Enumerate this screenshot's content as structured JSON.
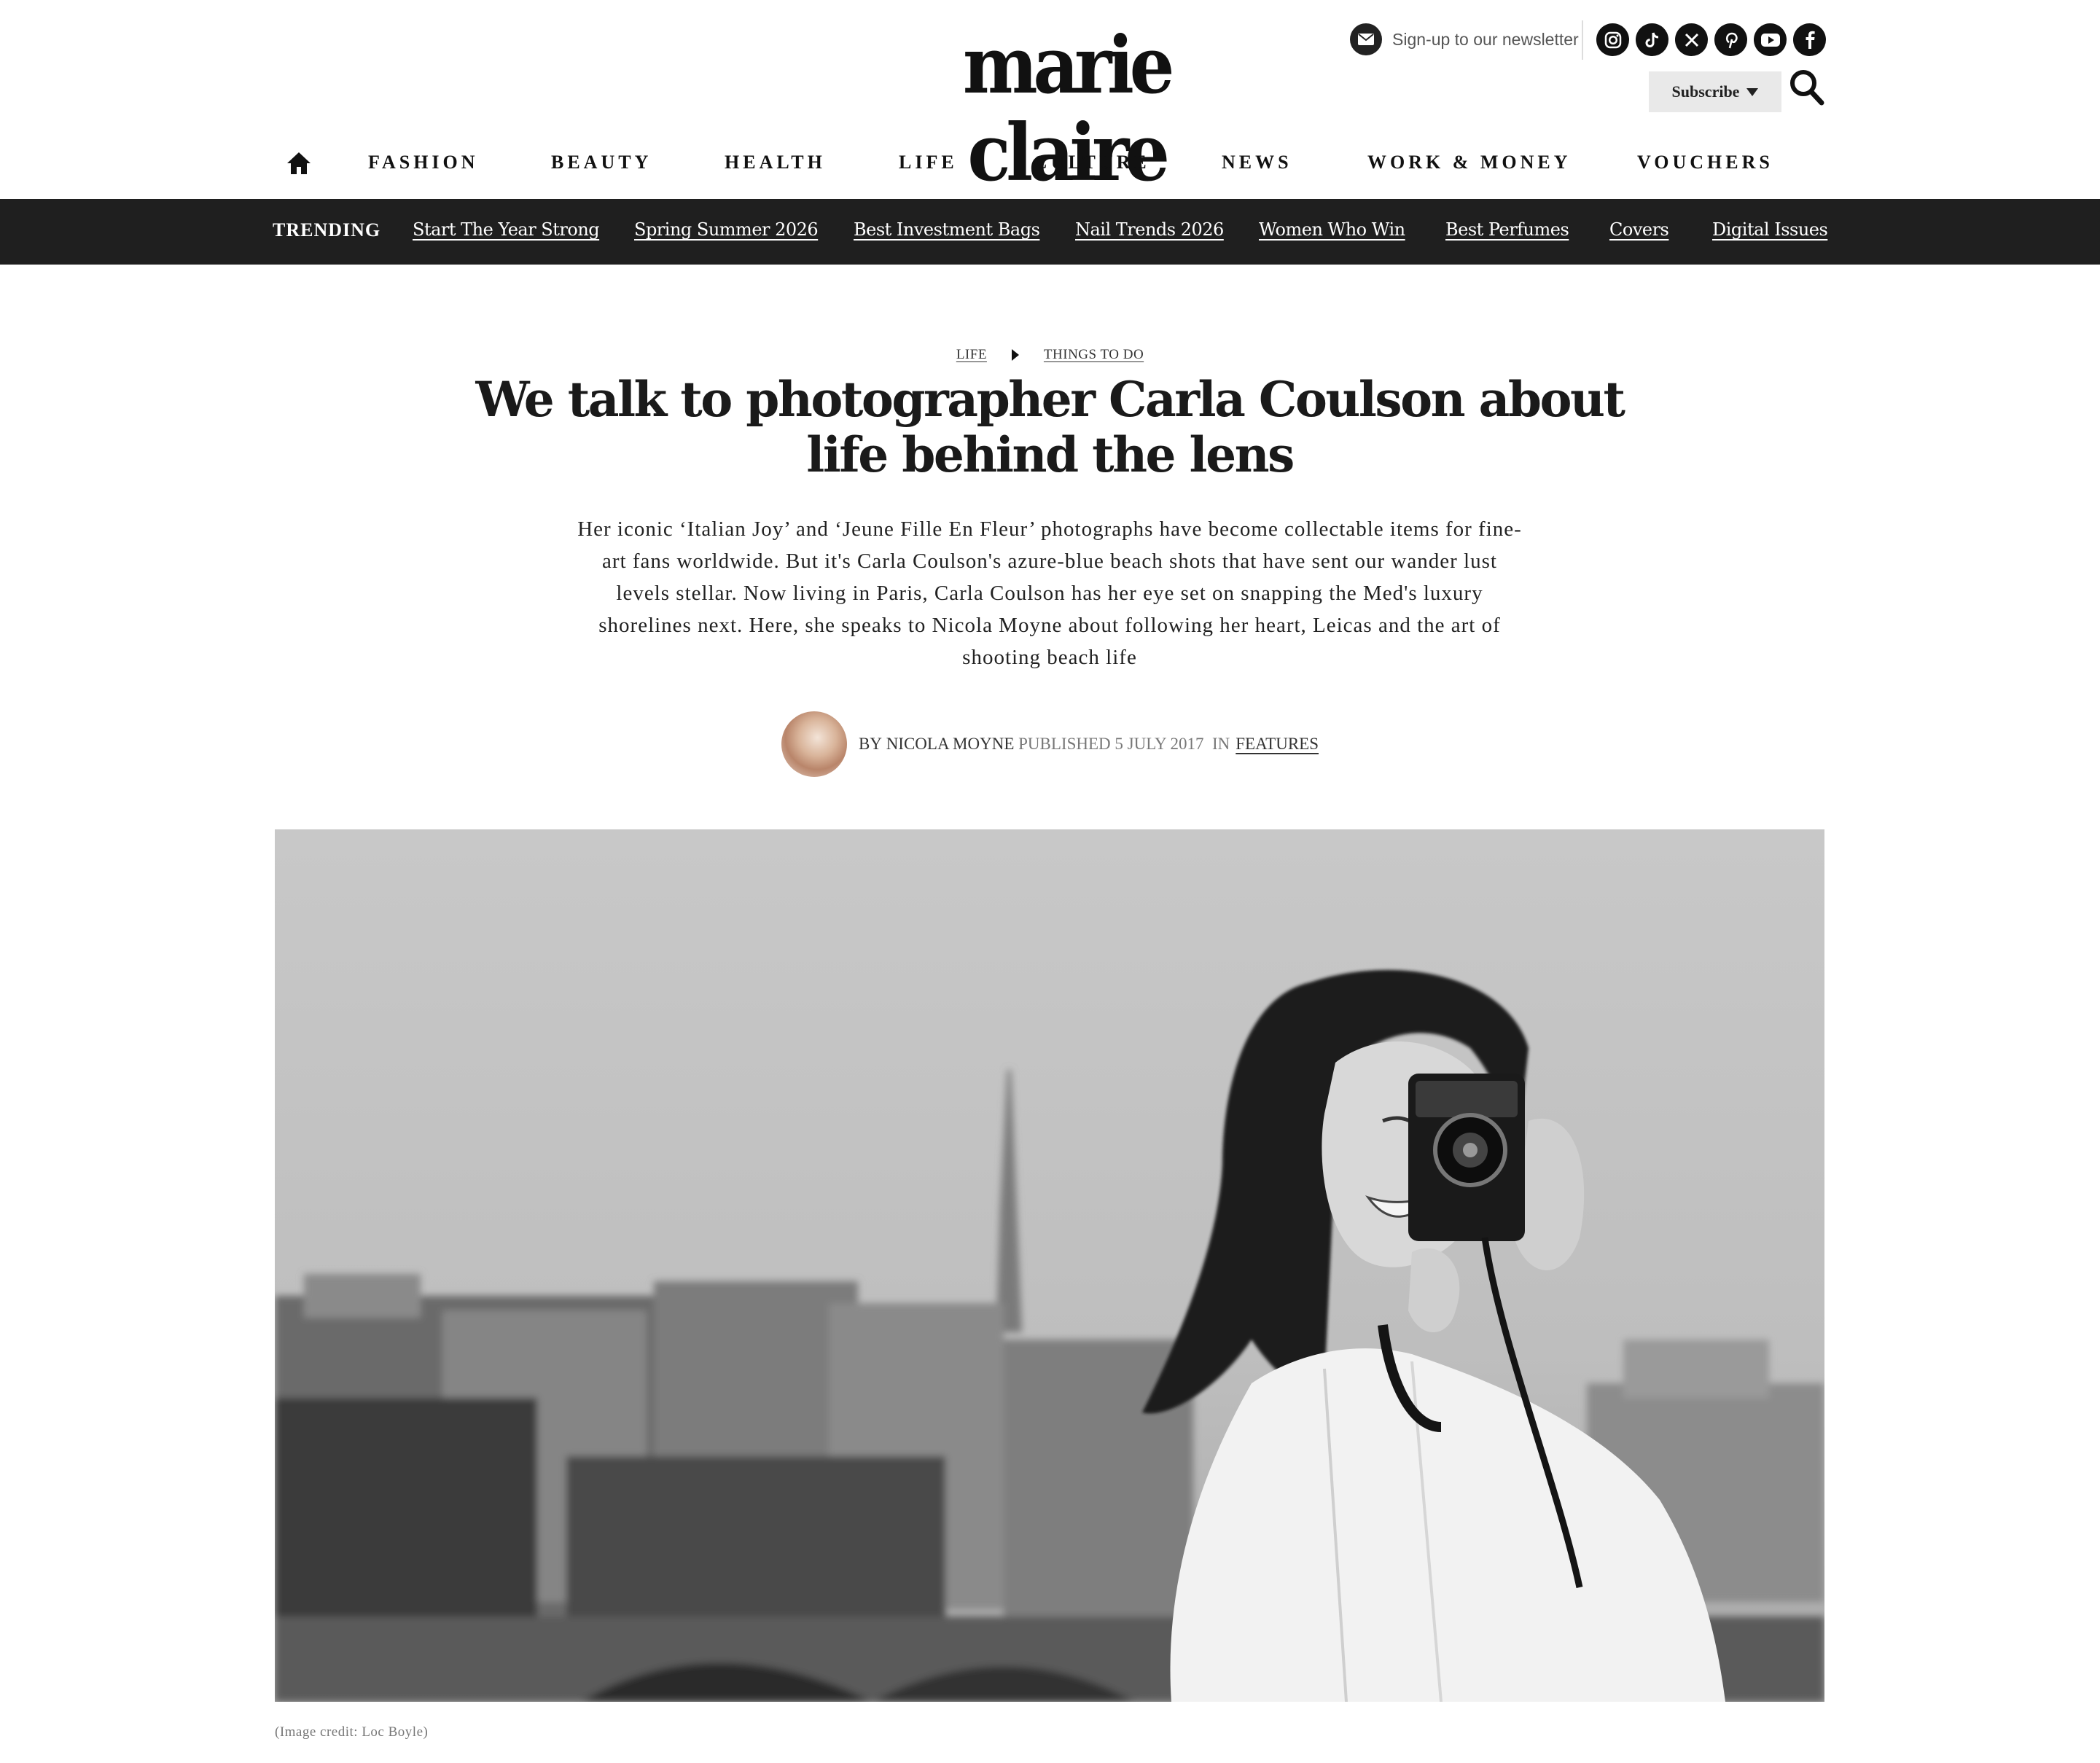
{
  "header": {
    "logo": "marie claire",
    "newsletter_label": "Sign-up to our newsletter",
    "subscribe_label": "Subscribe",
    "socials": [
      "instagram-icon",
      "tiktok-icon",
      "x-icon",
      "pinterest-icon",
      "youtube-icon",
      "facebook-icon"
    ]
  },
  "nav": {
    "items": [
      "FASHION",
      "BEAUTY",
      "HEALTH",
      "LIFE",
      "CULTURE",
      "NEWS",
      "WORK & MONEY",
      "VOUCHERS"
    ]
  },
  "trending": {
    "label": "TRENDING",
    "links": [
      "Start The Year Strong",
      "Spring Summer 2026",
      "Best Investment Bags",
      "Nail Trends 2026",
      "Women Who Win",
      "Best Perfumes",
      "Covers",
      "Digital Issues"
    ]
  },
  "article": {
    "breadcrumbs": [
      "LIFE",
      "THINGS TO DO"
    ],
    "title": "We talk to photographer Carla Coulson about life behind the lens",
    "standfirst": "Her iconic ‘Italian Joy’ and ‘Jeune Fille En Fleur’ photographs have become collectable items for fine-art fans worldwide. But it's Carla Coulson's azure-blue beach shots that have sent our wander lust levels stellar. Now living in Paris, Carla Coulson has her eye set on snapping the Med's luxury shorelines next. Here, she speaks to Nicola Moyne about following her heart, Leicas and the art of shooting beach life",
    "byline_prefix": "BY",
    "author": "NICOLA MOYNE",
    "published_prefix": "PUBLISHED",
    "published_date": "5 JULY 2017",
    "in_prefix": "IN",
    "category": "FEATURES",
    "image_caption": "(Image credit: Loc Boyle)"
  },
  "colors": {
    "trending_bg": "#1f1f1f",
    "text": "#111111",
    "subscribe_bg": "#e9e9e9"
  }
}
